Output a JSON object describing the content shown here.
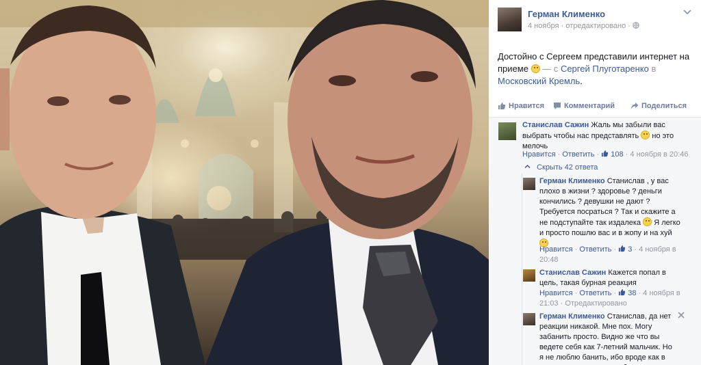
{
  "post": {
    "author": "Герман Клименко",
    "date": "4 ноября",
    "edited": "отредактировано",
    "text_main": "Достойно с Сергеем представили интернет на приеме",
    "text_with": "— с",
    "text_person": "Сергей Плуготаренко",
    "text_in": "в",
    "text_place": "Московский Кремль",
    "text_end": "."
  },
  "actions": {
    "like": "Нравится",
    "comment": "Комментарий",
    "share": "Поделиться"
  },
  "comments": [
    {
      "author": "Станислав Сажин",
      "text_a": "Жаль мы забыли вас выбрать чтобы нас представлять",
      "text_b": "но это мелочь",
      "like": "Нравится",
      "reply": "Ответить",
      "likes": "108",
      "time": "4 ноября в 20:46"
    }
  ],
  "replies_toggle": "Скрыть 42 ответа",
  "replies": [
    {
      "author": "Герман Клименко",
      "text_a": "Станислав , у вас плохо в жизни ? здоровье ? деньги кончились ? девушки не дают ? Требуется посраться ? Так и скажите а не подступайте так издалека",
      "text_b": "Я легко и просто пошлю вас и в жопу и на хуй",
      "like": "Нравится",
      "reply": "Ответить",
      "likes": "3",
      "time": "4 ноября в 20:48"
    },
    {
      "author": "Станислав Сажин",
      "text_a": "Кажется попал в цель, такая бурная реакция",
      "like": "Нравится",
      "reply": "Ответить",
      "likes": "38",
      "time": "4 ноября в 21:03",
      "edited": "Отредактировано"
    },
    {
      "author": "Герман Клименко",
      "text_a": "Станислав, да нет реакции никакой. Мне пох. Могу забанить просто. Видно же что вы ведете себя как 7-летний мальчик. Но я не люблю банить, ибо вроде как в индустрии все и при любых"
    }
  ],
  "colors": {
    "link": "#3b5998",
    "meta": "#9197a3",
    "text": "#141823",
    "comments_bg": "#f6f7f9"
  }
}
